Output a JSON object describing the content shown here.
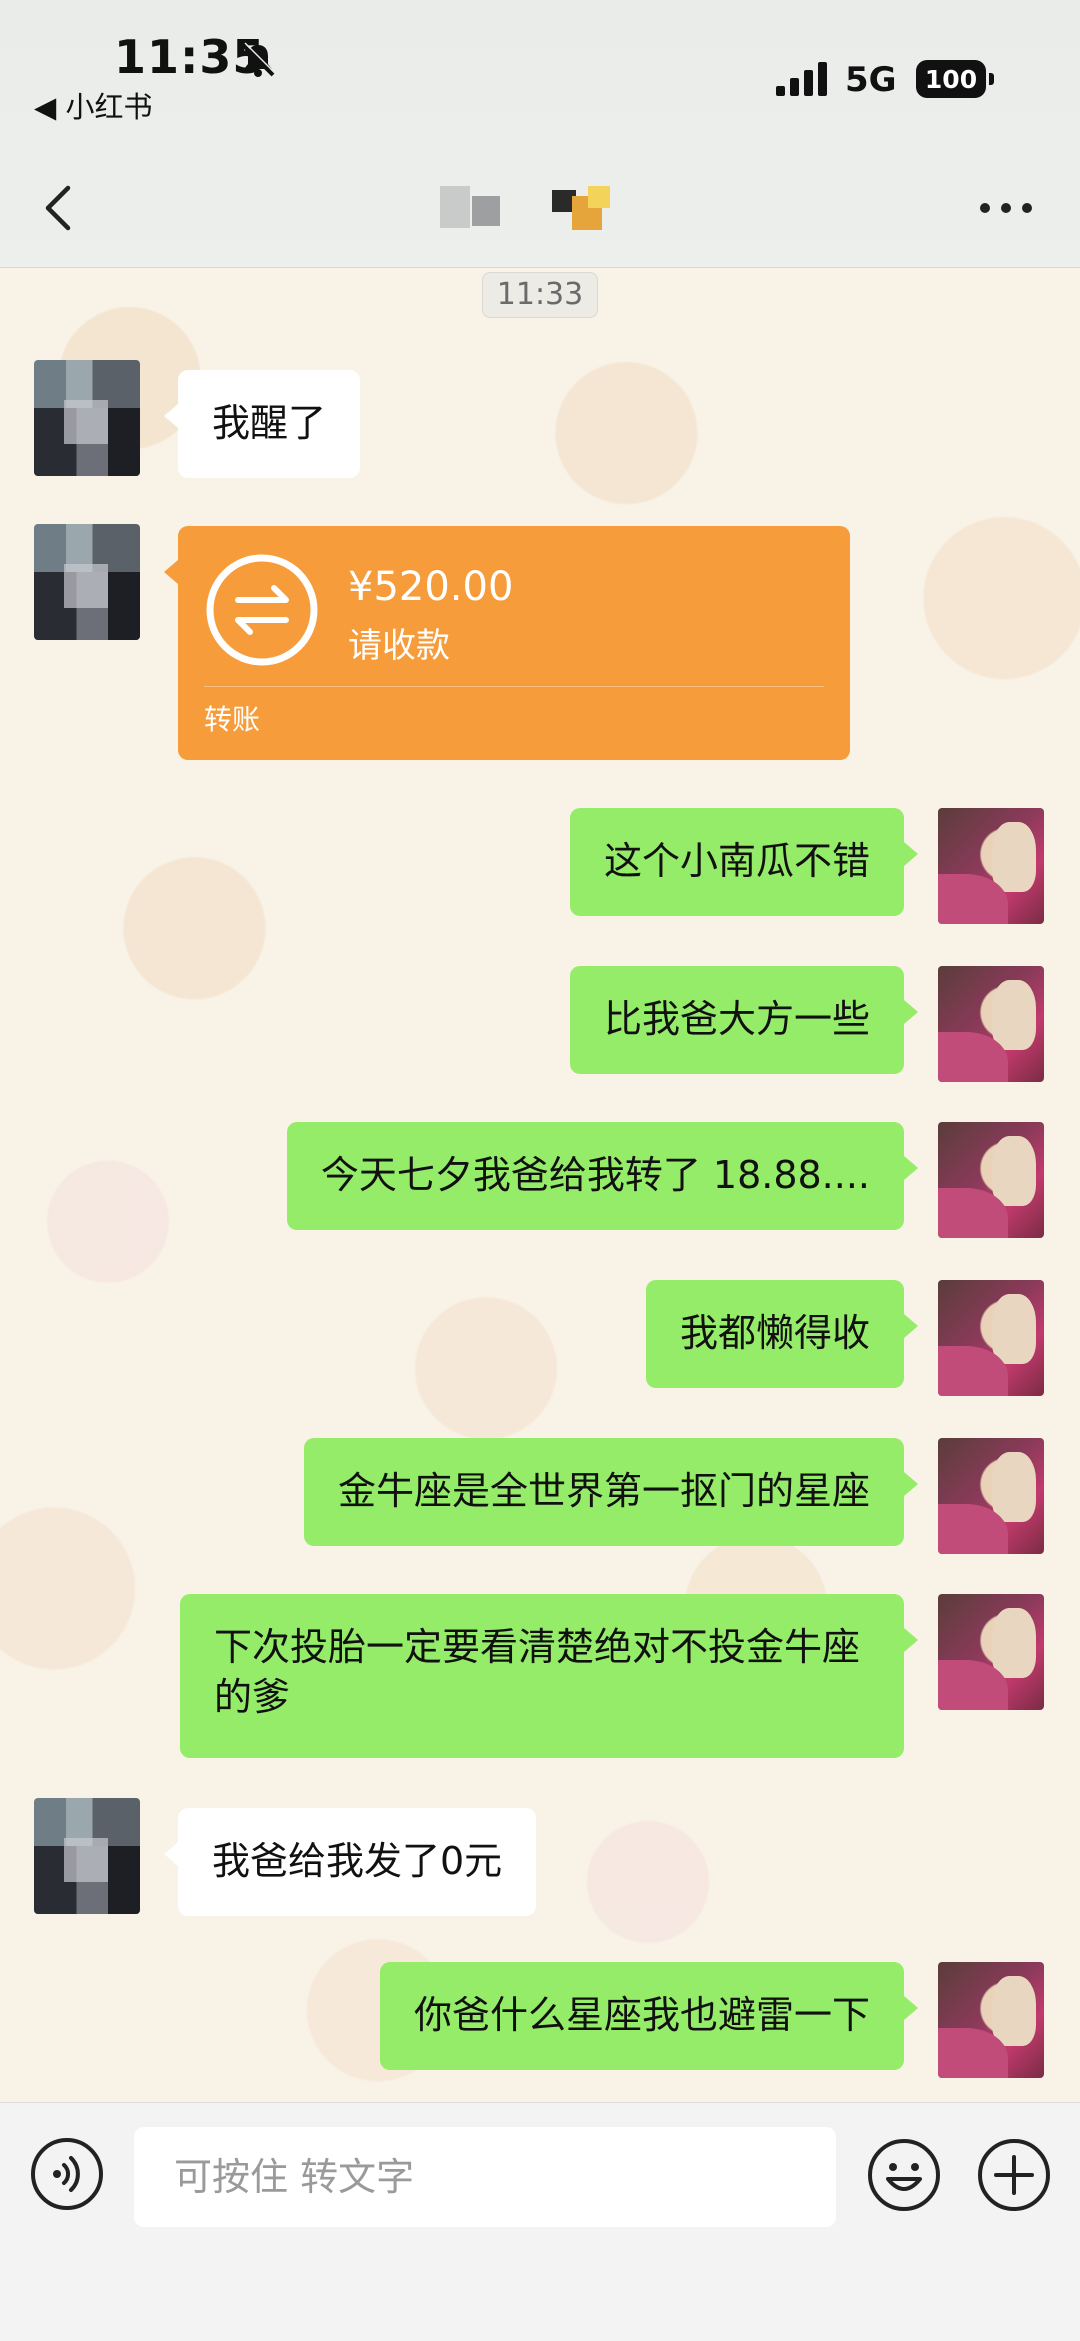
{
  "status_bar": {
    "time": "11:35",
    "back_app": "◀ 小红书",
    "network": "5G",
    "battery": "100"
  },
  "chat": {
    "timestamp": "11:33",
    "messages": [
      {
        "side": "left",
        "text": "我醒了"
      },
      {
        "side": "left",
        "type": "transfer",
        "amount": "¥520.00",
        "status": "请收款",
        "label": "转账"
      },
      {
        "side": "right",
        "text": "这个小南瓜不错"
      },
      {
        "side": "right",
        "text": "比我爸大方一些"
      },
      {
        "side": "right",
        "text": "今天七夕我爸给我转了 18.88...."
      },
      {
        "side": "right",
        "text": "我都懒得收"
      },
      {
        "side": "right",
        "text": "金牛座是全世界第一抠门的星座"
      },
      {
        "side": "right",
        "text": "下次投胎一定要看清楚绝对不投金牛座的爹"
      },
      {
        "side": "left",
        "text": "我爸给我发了0元"
      },
      {
        "side": "right",
        "text": "你爸什么星座我也避雷一下"
      }
    ]
  },
  "input_bar": {
    "placeholder": "可按住 转文字",
    "icons": [
      "voice-icon",
      "emoji-icon",
      "plus-icon"
    ]
  },
  "colors": {
    "bubble_right": "#95ec69",
    "bubble_left": "#ffffff",
    "transfer": "#f79c3a"
  }
}
